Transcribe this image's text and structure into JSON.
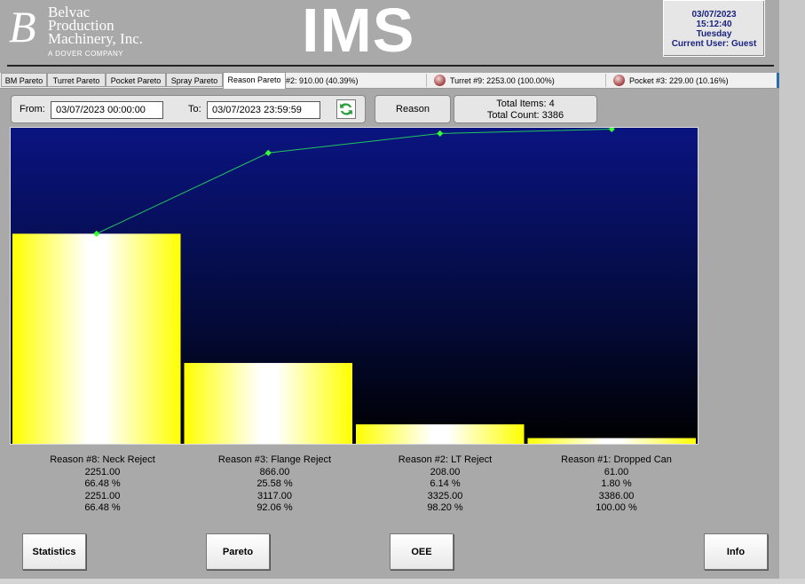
{
  "header": {
    "logo_letter": "B",
    "logo_text": "Belvac\nProduction\nMachinery, Inc.",
    "logo_subtext": "A DOVER COMPANY",
    "title": "IMS",
    "date": "03/07/2023",
    "time": "15:12:40",
    "day": "Tuesday",
    "user": "Current User: Guest"
  },
  "tabs": [
    {
      "label": "BM Pareto"
    },
    {
      "label": "Turret Pareto"
    },
    {
      "label": "Pocket Pareto"
    },
    {
      "label": "Spray Pareto"
    },
    {
      "label": "Reason Pareto",
      "active": true
    }
  ],
  "ticker": [
    {
      "text": "#2: 910.00 (40.39%)"
    },
    {
      "text": "Turret #9: 2253.00 (100.00%)"
    },
    {
      "text": "Pocket #3: 229.00 (10.16%)"
    }
  ],
  "toolbar": {
    "from_label": "From:",
    "from_value": "03/07/2023 00:00:00",
    "to_label": "To:",
    "to_value": "03/07/2023 23:59:59",
    "reason_button": "Reason",
    "total_items": "Total Items: 4",
    "total_count": "Total Count: 3386"
  },
  "chart_data": {
    "type": "bar",
    "categories": [
      "Reason #8: Neck Reject",
      "Reason #3: Flange Reject",
      "Reason #2: LT Reject",
      "Reason #1: Dropped Can"
    ],
    "values": [
      2251,
      866,
      208,
      61
    ],
    "percent": [
      66.48,
      25.58,
      6.14,
      1.8
    ],
    "cumulative": [
      2251,
      3117,
      3325,
      3386
    ],
    "cumulative_percent": [
      66.48,
      92.06,
      98.2,
      100.0
    ],
    "ylim": [
      0,
      3386
    ],
    "bar_color": "#ffff00",
    "line_color": "#22c55e",
    "background": [
      "#0a1480",
      "#000000"
    ]
  },
  "stats": [
    {
      "name": "Reason #8: Neck Reject",
      "count": "2251.00",
      "pct": "66.48 %",
      "cum": "2251.00",
      "cum_pct": "66.48 %"
    },
    {
      "name": "Reason #3: Flange Reject",
      "count": "866.00",
      "pct": "25.58 %",
      "cum": "3117.00",
      "cum_pct": "92.06 %"
    },
    {
      "name": "Reason #2: LT Reject",
      "count": "208.00",
      "pct": "6.14 %",
      "cum": "3325.00",
      "cum_pct": "98.20 %"
    },
    {
      "name": "Reason #1: Dropped Can",
      "count": "61.00",
      "pct": "1.80 %",
      "cum": "3386.00",
      "cum_pct": "100.00 %"
    }
  ],
  "buttons": {
    "statistics": "Statistics",
    "pareto": "Pareto",
    "oee": "OEE",
    "info": "Info"
  }
}
